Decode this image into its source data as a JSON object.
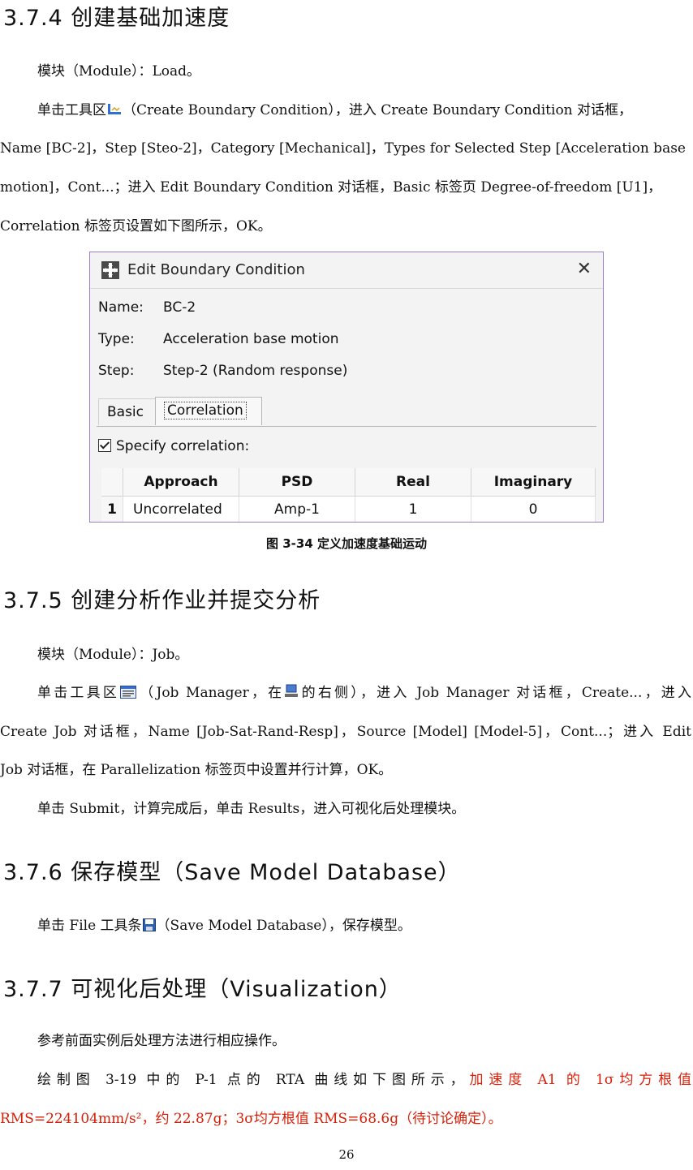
{
  "s374": {
    "heading": "3.7.4 创建基础加速度",
    "p1": "模块（Module）：Load。",
    "p2a": "单击工具区",
    "p2b": "（Create Boundary Condition），进入 Create Boundary Condition 对话框，",
    "p2c": "Name [BC-2]，Step [Steo-2]，Category [Mechanical]，Types for Selected Step [Acceleration base",
    "p2d": "motion]，Cont...；进入 Edit Boundary Condition 对话框，Basic 标签页 Degree-of-freedom [U1]，",
    "p2e": "Correlation 标签页设置如下图所示，OK。"
  },
  "dialog": {
    "title": "Edit Boundary Condition",
    "close": "✕",
    "name_label": "Name:",
    "name_value": "BC-2",
    "type_label": "Type:",
    "type_value": "Acceleration base motion",
    "step_label": "Step:",
    "step_value": "Step-2 (Random response)",
    "tab_basic": "Basic",
    "tab_correlation": "Correlation",
    "checkbox_label": "Specify correlation:",
    "columns": [
      "Approach",
      "PSD",
      "Real",
      "Imaginary"
    ],
    "row": {
      "num": "1",
      "approach": "Uncorrelated",
      "psd": "Amp-1",
      "real": "1",
      "imaginary": "0"
    }
  },
  "figure_caption": "图 3-34  定义加速度基础运动",
  "s375": {
    "heading": "3.7.5 创建分析作业并提交分析",
    "p1": "模块（Module）：Job。",
    "p2a": "单击工具区",
    "p2b": "（Job Manager，在",
    "p2c": "的右侧），进入 Job Manager 对话框，Create...，进入",
    "p2d": "Create Job 对话框，Name [Job-Sat-Rand-Resp]，Source [Model] [Model-5]，Cont...；进入 Edit",
    "p2e": "Job 对话框，在 Parallelization 标签页中设置并行计算，OK。",
    "p3": "单击 Submit，计算完成后，单击 Results，进入可视化后处理模块。"
  },
  "s376": {
    "heading": "3.7.6 保存模型（Save Model Database）",
    "p1a": "单击 File 工具条",
    "p1b": "（Save Model Database），保存模型。"
  },
  "s377": {
    "heading": "3.7.7 可视化后处理（Visualization）",
    "p1": "参考前面实例后处理方法进行相应操作。",
    "p2a": "绘制图 3-19 中的 P-1 点的 RTA 曲线如下图所示，",
    "p2b": "加速度 A1 的 1σ均方根值",
    "p2c": "RMS=224104mm/s²，约 22.87g；3σ均方根值 RMS=68.6g（待讨论确定）。"
  },
  "page_number": "26",
  "colors": {
    "red_text": "#d81e06",
    "dialog_border": "#9a7fc2"
  }
}
